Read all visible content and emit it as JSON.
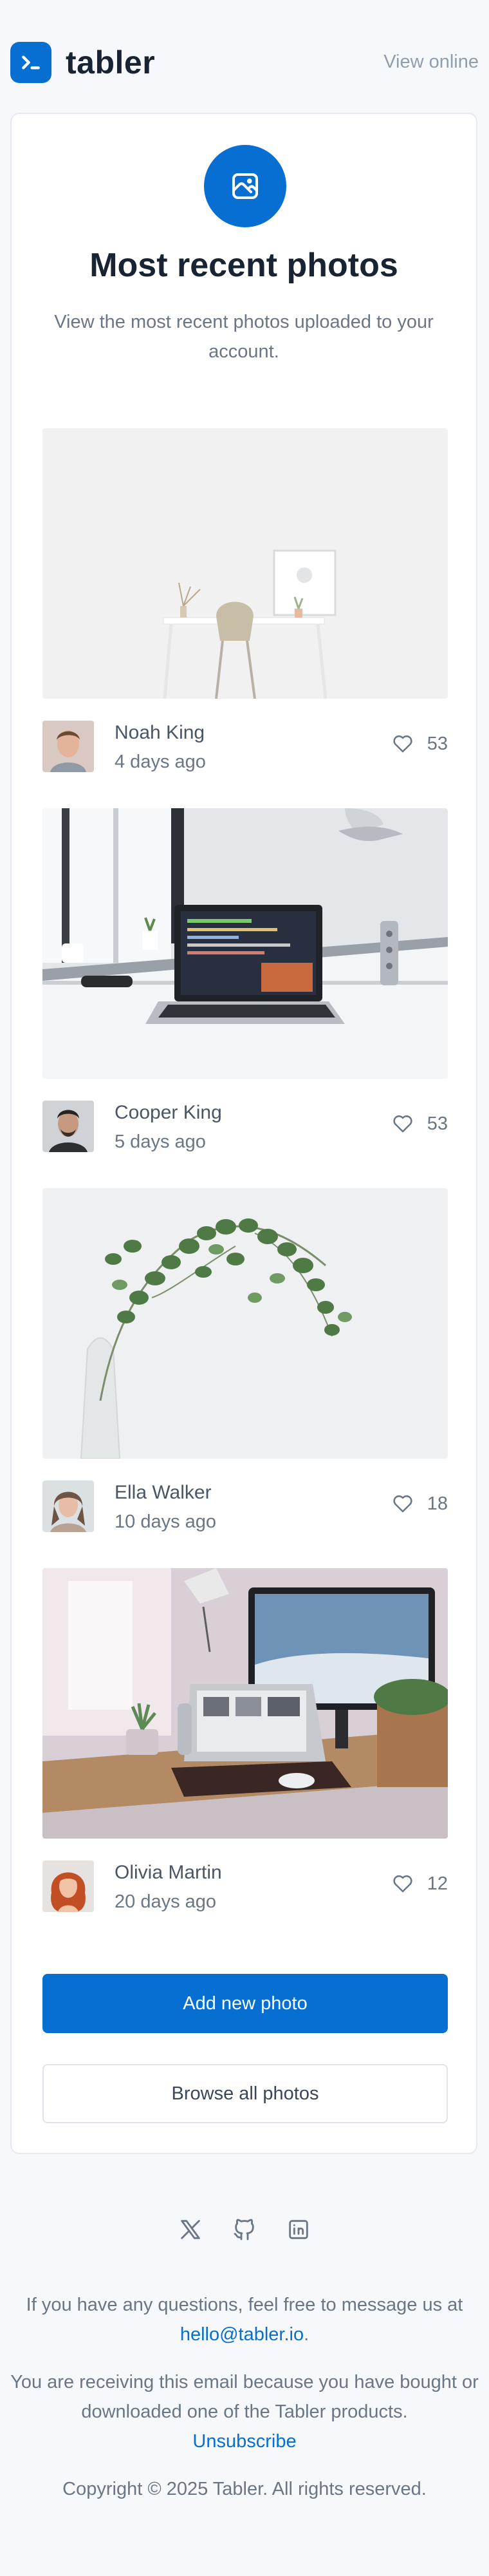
{
  "header": {
    "brand": "tabler",
    "view_online": "View online",
    "logo_icon": "terminal-icon"
  },
  "card": {
    "hero_icon": "photo-icon",
    "title": "Most recent photos",
    "subtitle": "View the most recent photos uploaded to your account.",
    "photos": [
      {
        "author": "Noah King",
        "time": "4 days ago",
        "likes": "53",
        "image": "white desk with chair and small vases"
      },
      {
        "author": "Cooper King",
        "time": "5 days ago",
        "likes": "53",
        "image": "laptop with code on desk near window"
      },
      {
        "author": "Ella Walker",
        "time": "10 days ago",
        "likes": "18",
        "image": "eucalyptus branch in glass vase"
      },
      {
        "author": "Olivia Martin",
        "time": "20 days ago",
        "likes": "12",
        "image": "desk with monitor, laptop and plant"
      }
    ],
    "add_button": "Add new photo",
    "browse_button": "Browse all photos"
  },
  "footer": {
    "social_icons": [
      "x-icon",
      "github-icon",
      "linkedin-icon"
    ],
    "questions_text": "If you have any questions, feel free to message us at",
    "email": "hello@tabler.io",
    "receiving_text": "You are receiving this email because you have bought or downloaded one of the Tabler products.",
    "unsubscribe": "Unsubscribe",
    "copyright": "Copyright © 2025 Tabler. All rights reserved."
  },
  "colors": {
    "accent": "#066fd1",
    "background": "#f6f8fb",
    "text": "#182433",
    "muted": "#6b7685"
  }
}
